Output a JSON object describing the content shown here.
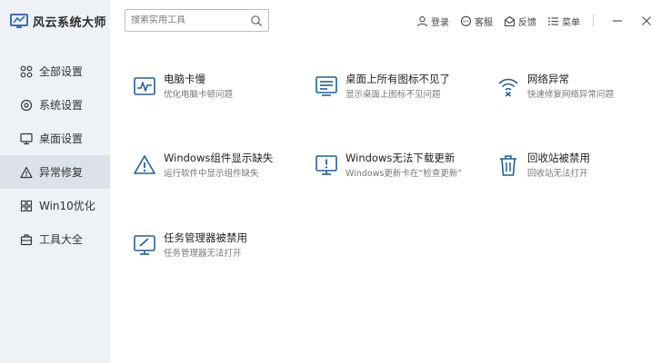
{
  "app": {
    "title": "风云系统大师"
  },
  "sidebar": {
    "items": [
      {
        "label": "全部设置",
        "icon": "grid-circles-icon"
      },
      {
        "label": "系统设置",
        "icon": "gear-icon"
      },
      {
        "label": "桌面设置",
        "icon": "monitor-icon"
      },
      {
        "label": "异常修复",
        "icon": "warning-triangle-icon"
      },
      {
        "label": "Win10优化",
        "icon": "windows-logo-icon"
      },
      {
        "label": "工具大全",
        "icon": "toolbox-icon"
      }
    ],
    "active_index": 3
  },
  "search": {
    "placeholder": "搜索实用工具"
  },
  "topbar": {
    "login": "登录",
    "service": "客服",
    "feedback": "反馈",
    "menu": "菜单"
  },
  "cards": [
    {
      "title": "电脑卡慢",
      "desc": "优化电脑卡顿问题",
      "icon": "pulse-chart-icon"
    },
    {
      "title": "桌面上所有图标不见了",
      "desc": "显示桌面上图标不见问题",
      "icon": "desktop-list-icon"
    },
    {
      "title": "网络异常",
      "desc": "快速修复网络异常问题",
      "icon": "wifi-error-icon"
    },
    {
      "title": "Windows组件显示缺失",
      "desc": "运行软件中显示组件缺失",
      "icon": "warning-triangle-icon"
    },
    {
      "title": "Windows无法下载更新",
      "desc": "Windows更新卡在“检查更新”",
      "icon": "monitor-alert-icon"
    },
    {
      "title": "回收站被禁用",
      "desc": "回收站无法打开",
      "icon": "trash-icon"
    },
    {
      "title": "任务管理器被禁用",
      "desc": "任务管理器无法打开",
      "icon": "monitor-check-icon"
    }
  ],
  "colors": {
    "accent": "#1f5f9e",
    "sidebar_bg": "#eef1f6",
    "sidebar_active": "#dde2ea"
  }
}
